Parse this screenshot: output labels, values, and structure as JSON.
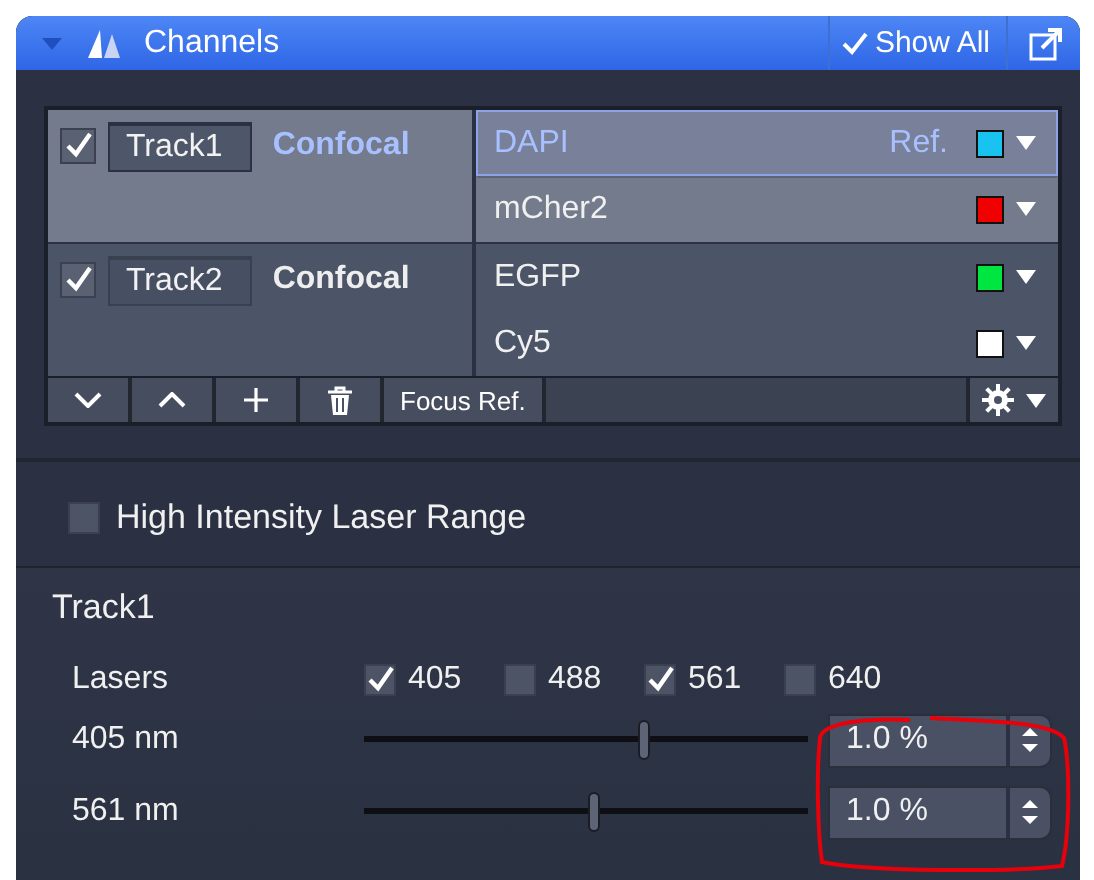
{
  "panel": {
    "title": "Channels",
    "show_all": {
      "label": "Show All",
      "checked": true
    }
  },
  "tracks": [
    {
      "checked": true,
      "name": "Track1",
      "mode": "Confocal",
      "selected": true,
      "channels": [
        {
          "name": "DAPI",
          "ref": "Ref.",
          "color": "#19c3f0",
          "selected": true
        },
        {
          "name": "mCher2",
          "color": "#f00000",
          "selected": false
        }
      ]
    },
    {
      "checked": true,
      "name": "Track2",
      "mode": "Confocal",
      "selected": false,
      "channels": [
        {
          "name": "EGFP",
          "color": "#00e640",
          "selected": false
        },
        {
          "name": "Cy5",
          "color": "#ffffff",
          "selected": false
        }
      ]
    }
  ],
  "toolbar": {
    "focus_button": "Focus Ref."
  },
  "high_intensity": {
    "label": "High Intensity Laser Range",
    "checked": false
  },
  "track_section": {
    "title": "Track1",
    "lasers_label": "Lasers",
    "lasers": [
      {
        "label": "405",
        "checked": true
      },
      {
        "label": "488",
        "checked": false
      },
      {
        "label": "561",
        "checked": true
      },
      {
        "label": "640",
        "checked": false
      }
    ],
    "sliders": [
      {
        "label": "405 nm",
        "level": 0.63,
        "value": "1.0 %"
      },
      {
        "label": "561 nm",
        "level": 0.52,
        "value": "1.0 %"
      }
    ]
  }
}
